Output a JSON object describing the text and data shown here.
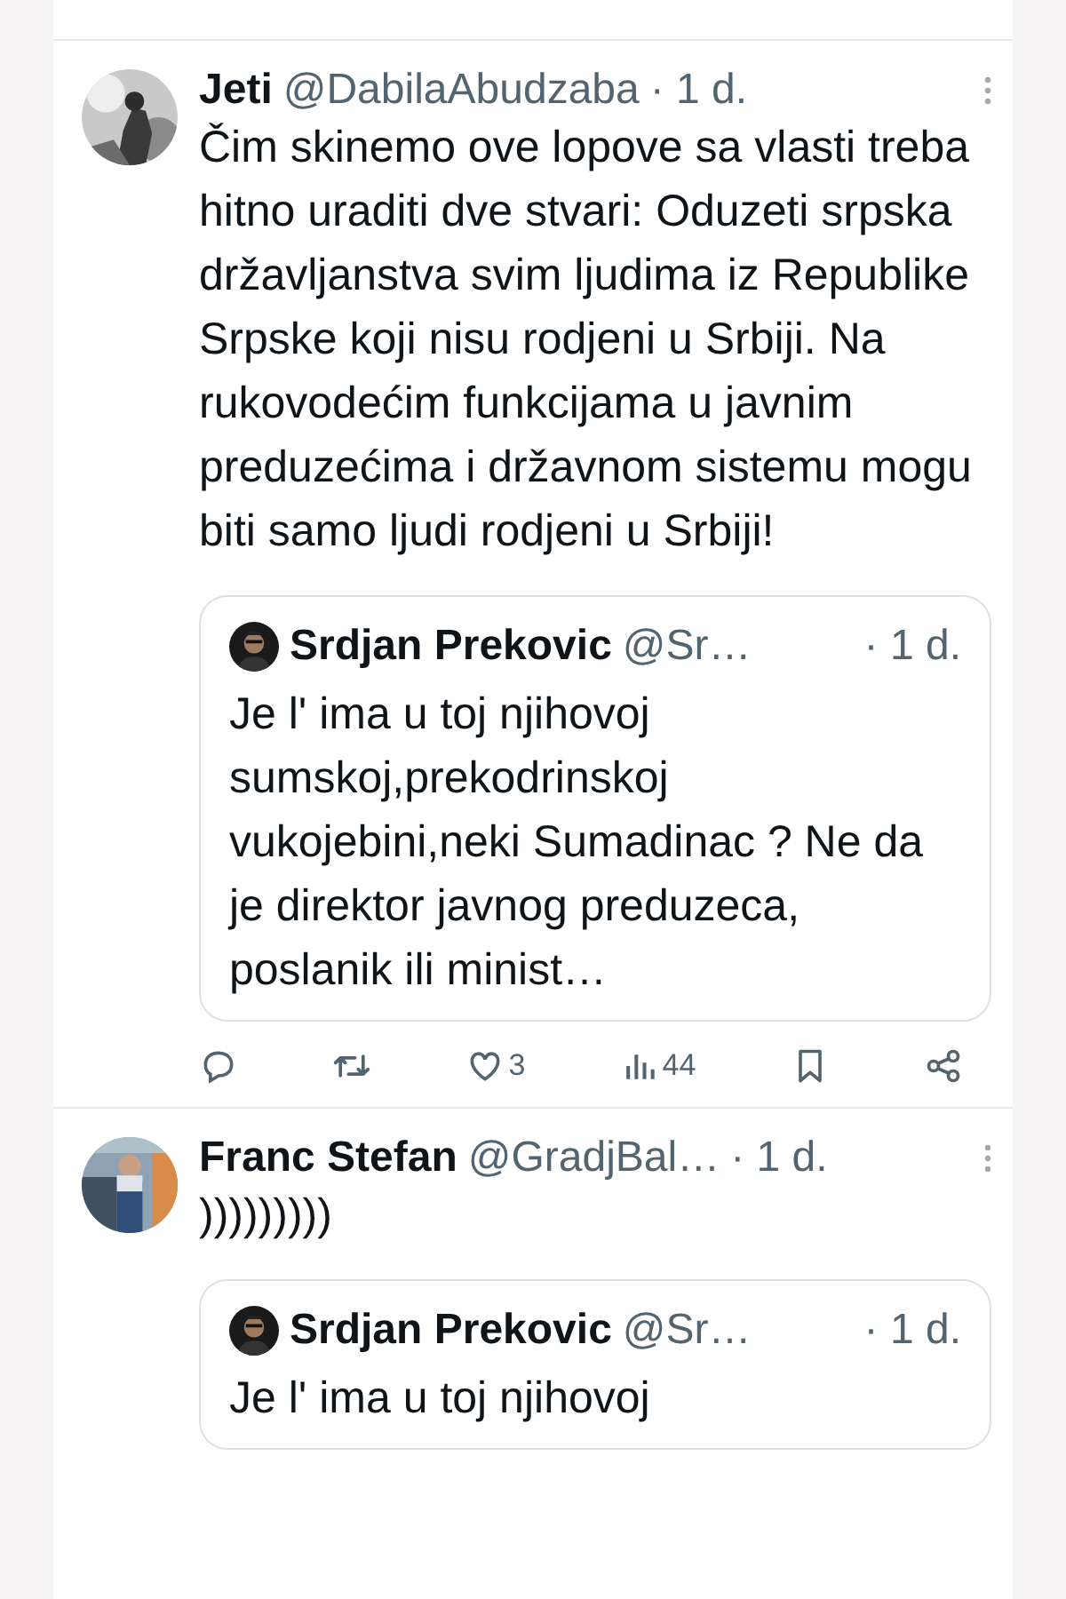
{
  "tweets": [
    {
      "author": "Jeti",
      "handle": "@DabilaAbudzaba",
      "time": "· 1 d.",
      "text": "Čim skinemo ove lopove sa vlasti treba hitno uraditi dve stvari: Oduzeti srpska državljanstva svim ljudima iz Republike Srpske koji nisu rodjeni u Srbiji. Na rukovodećim funkcijama u javnim preduzećima i državnom sistemu mogu biti samo ljudi rodjeni u Srbiji!",
      "quote": {
        "author": "Srdjan Prekovic",
        "handle": "@Sr…",
        "time": "· 1 d.",
        "text": "Je l' ima u toj njihovoj sumskoj,prekodrinskoj vukojebini,neki Sumadinac ? Ne da je direktor javnog preduzeca, poslanik ili minist…"
      },
      "actions": [
        {
          "kind": "reply"
        },
        {
          "kind": "retweet"
        },
        {
          "kind": "like",
          "count": "3"
        },
        {
          "kind": "views",
          "count": "44"
        },
        {
          "kind": "bookmark"
        },
        {
          "kind": "share"
        }
      ]
    },
    {
      "author": "Franc Stefan",
      "handle": "@GradjBal…",
      "time": "· 1 d.",
      "text": ")))))))))",
      "quote": {
        "author": "Srdjan Prekovic",
        "handle": "@Sr…",
        "time": "· 1 d.",
        "text": "Je l' ima u toj njihovoj"
      }
    }
  ]
}
